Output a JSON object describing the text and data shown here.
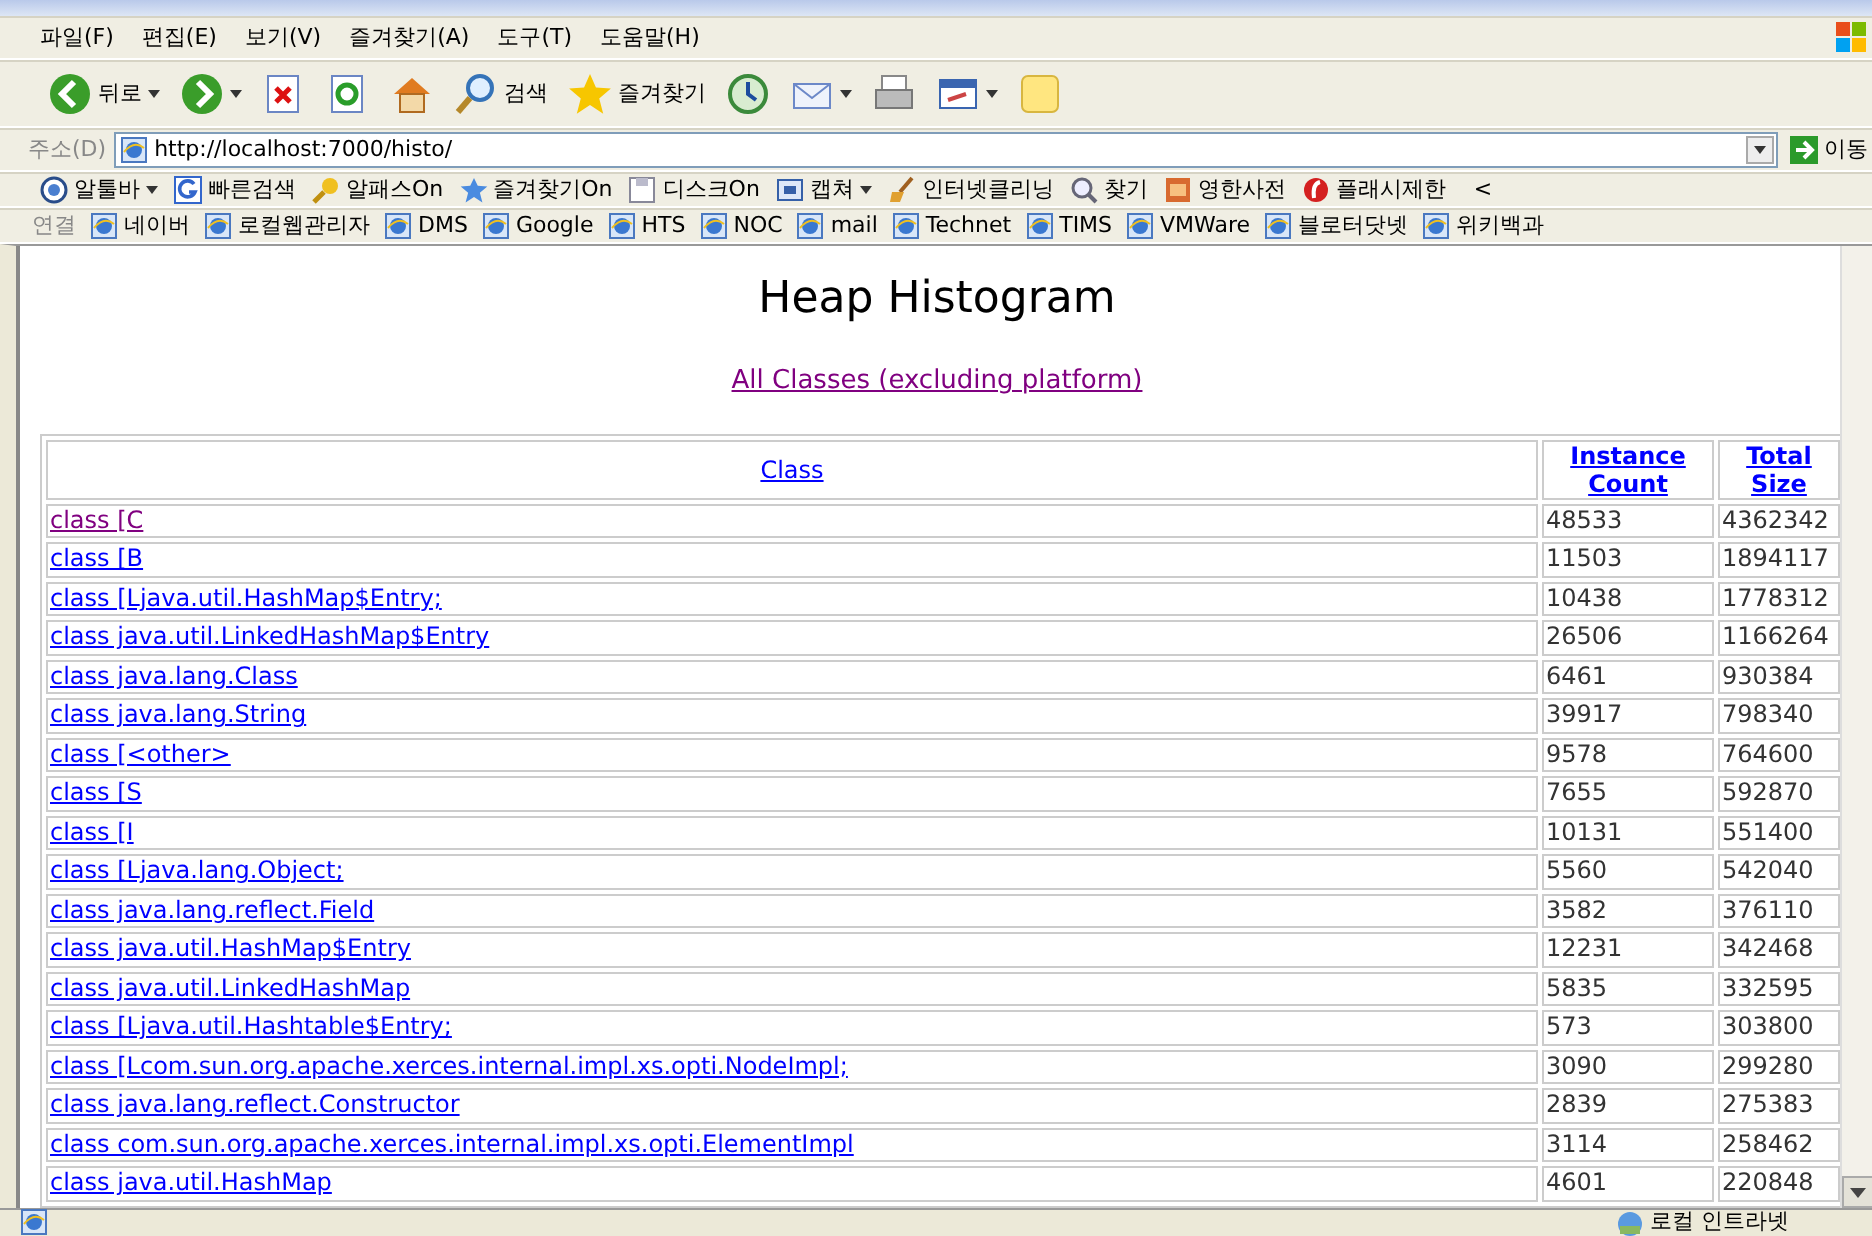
{
  "menu": [
    "파일(F)",
    "편집(E)",
    "보기(V)",
    "즐겨찾기(A)",
    "도구(T)",
    "도움말(H)"
  ],
  "nav_buttons": [
    {
      "kind": "back",
      "label": "뒤로",
      "dropdown": true
    },
    {
      "kind": "forward",
      "dropdown": true
    },
    {
      "kind": "stop"
    },
    {
      "kind": "refresh"
    },
    {
      "kind": "home"
    },
    {
      "kind": "search",
      "label": "검색"
    },
    {
      "kind": "favorites",
      "label": "즐겨찾기"
    },
    {
      "kind": "history"
    },
    {
      "kind": "mail",
      "dropdown": true
    },
    {
      "kind": "print"
    },
    {
      "kind": "edit",
      "dropdown": true
    },
    {
      "kind": "note"
    }
  ],
  "address": {
    "label": "주소(D)",
    "value": "http://localhost:7000/histo/",
    "go": "이동"
  },
  "addon_bar": {
    "items": [
      {
        "kind": "altool",
        "label": "알툴바",
        "dropdown": true
      },
      {
        "kind": "google",
        "label": "빠른검색"
      },
      {
        "kind": "key",
        "label": "알패스On"
      },
      {
        "kind": "star",
        "label": "즐겨찾기On"
      },
      {
        "kind": "disk",
        "label": "디스크On"
      },
      {
        "kind": "capture",
        "label": "캡쳐",
        "dropdown": true
      },
      {
        "kind": "broom",
        "label": "인터넷클리닝"
      },
      {
        "kind": "find",
        "label": "찾기"
      },
      {
        "kind": "dict",
        "label": "영한사전"
      },
      {
        "kind": "flash",
        "label": "플래시제한"
      }
    ],
    "more": "<"
  },
  "links_bar": {
    "label": "연결",
    "items": [
      "네이버",
      "로컬웹관리자",
      "DMS",
      "Google",
      "HTS",
      "NOC",
      "mail",
      "Technet",
      "TIMS",
      "VMWare",
      "블로터닷넷",
      "위키백과"
    ]
  },
  "page": {
    "title": "Heap Histogram",
    "link": {
      "text": "All Classes (excluding platform)",
      "visited": true
    },
    "columns": [
      "Class",
      "Instance Count",
      "Total Size"
    ],
    "rows": [
      {
        "class": "class [C",
        "count": "48533",
        "size": "4362342",
        "visited": true
      },
      {
        "class": "class [B",
        "count": "11503",
        "size": "1894117",
        "visited": false
      },
      {
        "class": "class [Ljava.util.HashMap$Entry;",
        "count": "10438",
        "size": "1778312",
        "visited": false
      },
      {
        "class": "class java.util.LinkedHashMap$Entry",
        "count": "26506",
        "size": "1166264",
        "visited": false
      },
      {
        "class": "class java.lang.Class",
        "count": "6461",
        "size": "930384",
        "visited": false
      },
      {
        "class": "class java.lang.String",
        "count": "39917",
        "size": "798340",
        "visited": false
      },
      {
        "class": "class [<other>",
        "count": "9578",
        "size": "764600",
        "visited": false
      },
      {
        "class": "class [S",
        "count": "7655",
        "size": "592870",
        "visited": false
      },
      {
        "class": "class [I",
        "count": "10131",
        "size": "551400",
        "visited": false
      },
      {
        "class": "class [Ljava.lang.Object;",
        "count": "5560",
        "size": "542040",
        "visited": false
      },
      {
        "class": "class java.lang.reflect.Field",
        "count": "3582",
        "size": "376110",
        "visited": false
      },
      {
        "class": "class java.util.HashMap$Entry",
        "count": "12231",
        "size": "342468",
        "visited": false
      },
      {
        "class": "class java.util.LinkedHashMap",
        "count": "5835",
        "size": "332595",
        "visited": false
      },
      {
        "class": "class [Ljava.util.Hashtable$Entry;",
        "count": "573",
        "size": "303800",
        "visited": false
      },
      {
        "class": "class [Lcom.sun.org.apache.xerces.internal.impl.xs.opti.NodeImpl;",
        "count": "3090",
        "size": "299280",
        "visited": false
      },
      {
        "class": "class java.lang.reflect.Constructor",
        "count": "2839",
        "size": "275383",
        "visited": false
      },
      {
        "class": "class com.sun.org.apache.xerces.internal.impl.xs.opti.ElementImpl",
        "count": "3114",
        "size": "258462",
        "visited": false
      },
      {
        "class": "class java.util.HashMap",
        "count": "4601",
        "size": "220848",
        "visited": false
      }
    ]
  },
  "status_bar": {
    "zone": "로컬 인트라넷"
  }
}
